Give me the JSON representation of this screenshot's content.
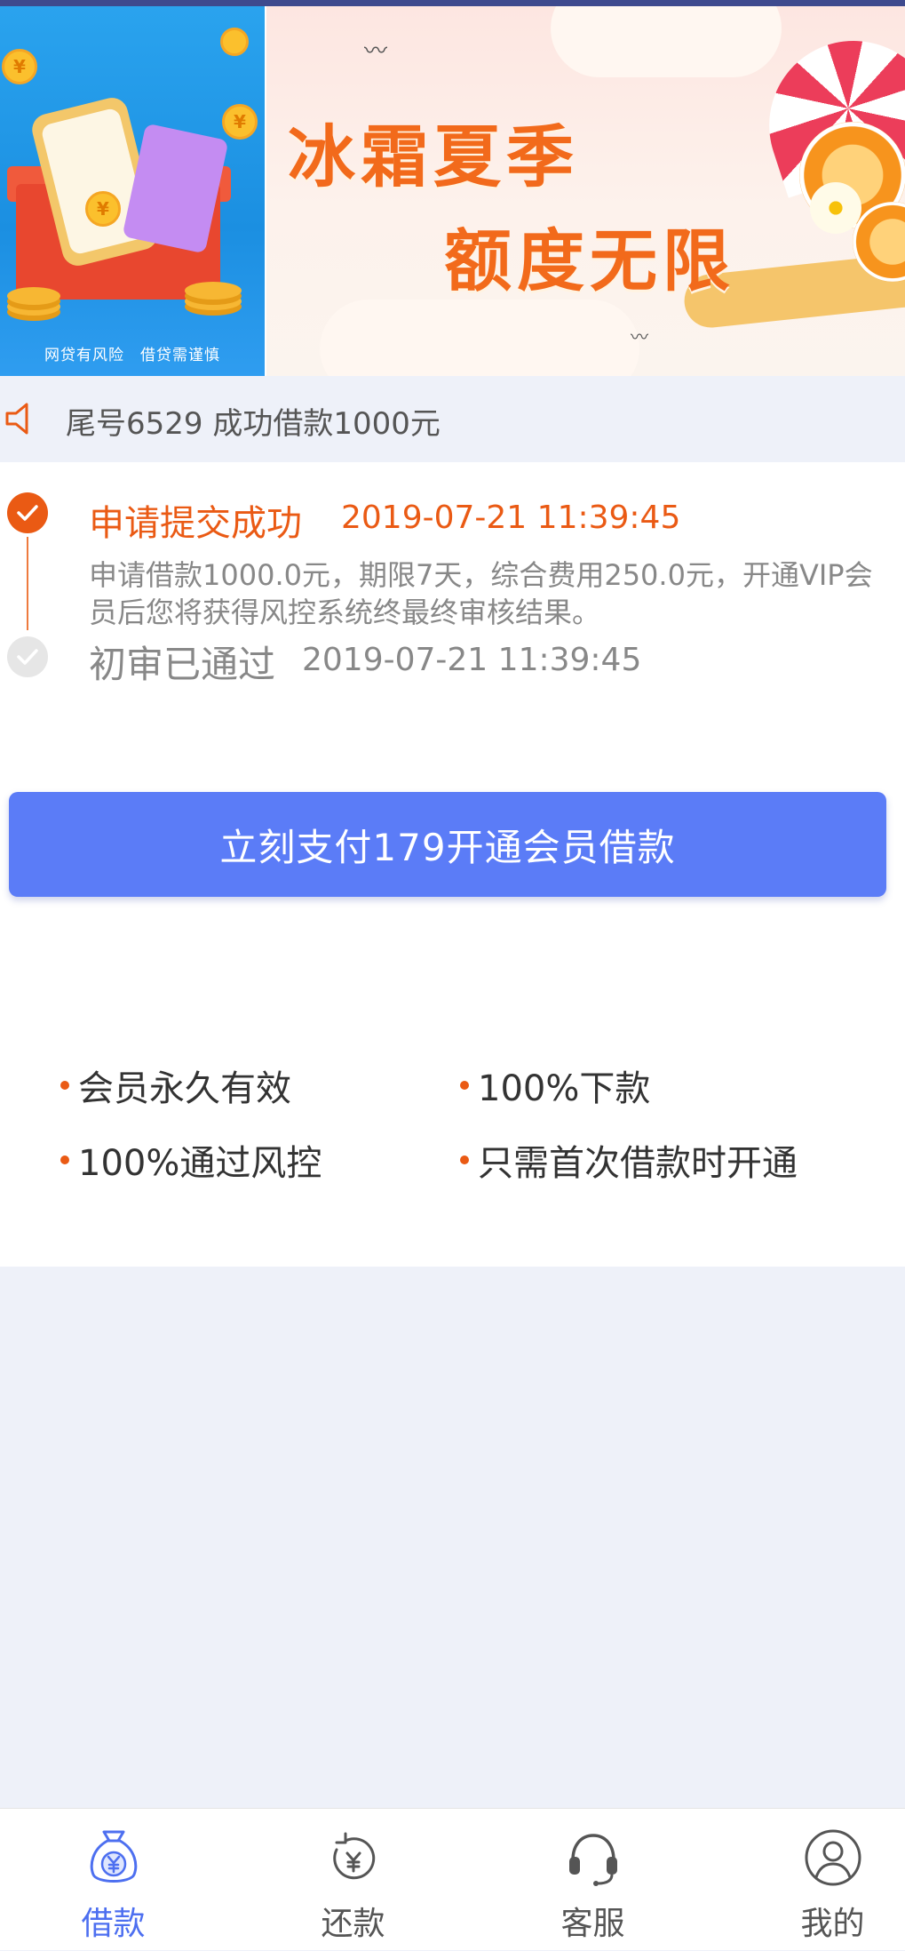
{
  "banner": {
    "left_caption": "网贷有风险　借贷需谨慎",
    "title_line1": "冰霜夏季",
    "title_line2": "额度无限",
    "coin_symbol": "¥"
  },
  "marquee": {
    "text": "尾号6529 成功借款1000元"
  },
  "status": {
    "step1": {
      "title": "申请提交成功",
      "time": "2019-07-21 11:39:45",
      "desc": "申请借款1000.0元，期限7天，综合费用250.0元，开通VIP会员后您将获得风控系统终最终审核结果。"
    },
    "step2": {
      "title": "初审已通过",
      "time": "2019-07-21 11:39:45"
    }
  },
  "pay_button": {
    "label": "立刻支付179开通会员借款"
  },
  "benefits": [
    "会员永久有效",
    "100%下款",
    "100%通过风控",
    "只需首次借款时开通"
  ],
  "nav": {
    "items": [
      {
        "label": "借款",
        "icon": "money-bag-icon",
        "active": true
      },
      {
        "label": "还款",
        "icon": "repay-icon",
        "active": false
      },
      {
        "label": "客服",
        "icon": "headset-icon",
        "active": false
      },
      {
        "label": "我的",
        "icon": "user-icon",
        "active": false
      }
    ]
  },
  "colors": {
    "accent": "#ea5a14",
    "button": "#5b7cf7",
    "nav_active": "#4d6ff0"
  }
}
